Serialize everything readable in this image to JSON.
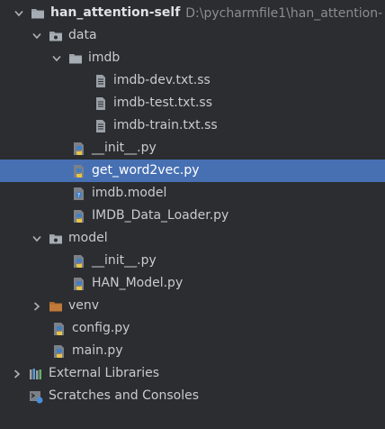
{
  "project": {
    "name": "han_attention-self",
    "path": "D:\\pycharmfile1\\han_attention-"
  },
  "items": [
    {
      "label": "data"
    },
    {
      "label": "imdb"
    },
    {
      "label": "imdb-dev.txt.ss"
    },
    {
      "label": "imdb-test.txt.ss"
    },
    {
      "label": "imdb-train.txt.ss"
    },
    {
      "label": "__init__.py"
    },
    {
      "label": "get_word2vec.py"
    },
    {
      "label": "imdb.model"
    },
    {
      "label": "IMDB_Data_Loader.py"
    },
    {
      "label": "model"
    },
    {
      "label": "__init__.py"
    },
    {
      "label": "HAN_Model.py"
    },
    {
      "label": "venv"
    },
    {
      "label": "config.py"
    },
    {
      "label": "main.py"
    },
    {
      "label": "External Libraries"
    },
    {
      "label": "Scratches and Consoles"
    }
  ],
  "colors": {
    "background": "#2b2d30",
    "selection": "#4770b3",
    "folder_gray": "#9aa0a8",
    "folder_orange": "#c07a3a",
    "python_blue": "#3f7fc4",
    "python_yellow": "#e7c547"
  },
  "icons": {
    "folder": "folder-icon",
    "file": "text-file-icon",
    "python": "python-file-icon",
    "model": "model-file-icon",
    "libraries": "external-libraries-icon",
    "scratches": "scratches-icon"
  }
}
